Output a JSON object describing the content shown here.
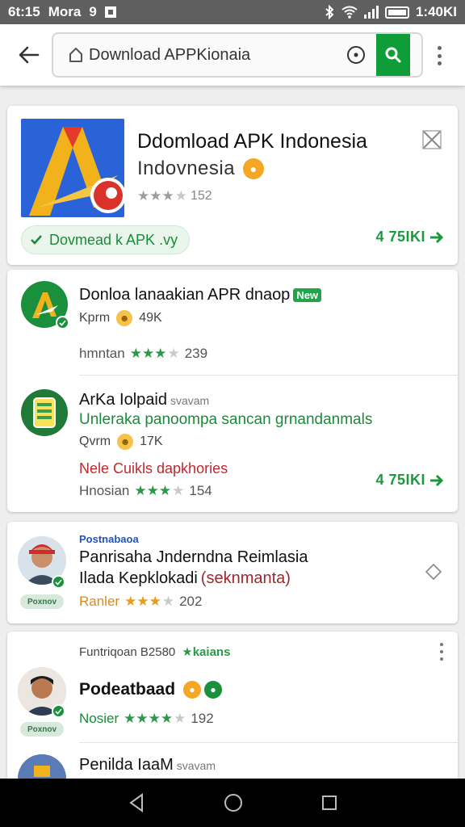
{
  "status_bar": {
    "time": "6t:15",
    "carrier": "Mora",
    "extra": "9",
    "clock_right": "1:40KI"
  },
  "toolbar": {
    "search_value": "Download APPKionaia"
  },
  "hero": {
    "title": "Ddomload APK Indonesia",
    "subtitle": "Indovnesia",
    "rating_count": "152",
    "download_label": "Dovmead k APK .vy",
    "count_label": "4 75IKI"
  },
  "list": [
    {
      "title": "Donloa lanaakian APR dnaop",
      "badge": "New",
      "meta": "Kprm",
      "size": "49K",
      "rating_label": "hmntan",
      "rating_count": "239"
    },
    {
      "title": "ArKa Iolpaid",
      "title_suffix": "svavam",
      "desc": "Unleraka panoompa sancan grnandanmals",
      "meta": "Qvrm",
      "size": "17K",
      "note": "Nele Cuikls dapkhories",
      "rating_label": "Hnosian",
      "rating_count": "154",
      "count_label": "4 75IKI"
    }
  ],
  "review_1": {
    "tag": "Postnabaoa",
    "line1": "Panrisaha Jnderndna Reimlasia",
    "line2_a": "Ilada Kepklokadi",
    "line2_b": "(seknmanta)",
    "avatar_badge": "Poxnov",
    "rating_label": "Ranler",
    "rating_count": "202"
  },
  "review_2": {
    "header": "Funtriqoan B2580",
    "header_tag": "★kaians",
    "name": "Podeatbaad",
    "avatar_badge": "Poxnov",
    "rating_label": "Nosier",
    "rating_count": "192"
  },
  "review_3": {
    "name": "Penilda IaaM",
    "suffix": "svavam"
  },
  "colors": {
    "accent_green": "#0f9d3a",
    "brand_blue": "#2a62d8",
    "warning_red": "#c0282d",
    "badge_orange": "#f5a623"
  },
  "ratings": {
    "hero_filled": 3,
    "row1_filled": 3,
    "row2_filled": 3,
    "review1_filled": 3,
    "review2_filled": 4,
    "out_of": 4
  }
}
